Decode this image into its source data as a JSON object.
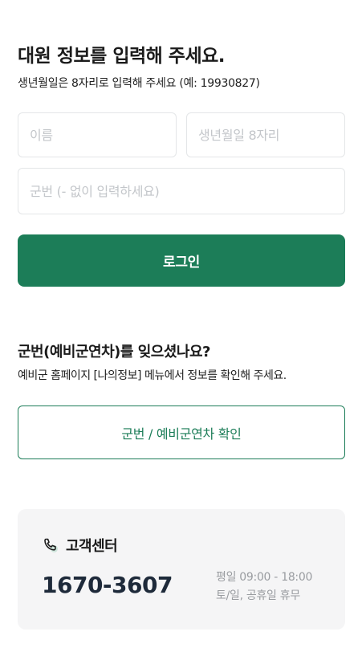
{
  "header": {
    "title": "대원 정보를 입력해 주세요.",
    "subtitle": "생년월일은 8자리로 입력해 주세요 (예: 19930827)"
  },
  "form": {
    "name_placeholder": "이름",
    "birth_placeholder": "생년월일 8자리",
    "service_number_placeholder": "군번 (- 없이 입력하세요)",
    "login_label": "로그인"
  },
  "forgot": {
    "title": "군번(예비군연차)를 잊으셨나요?",
    "description": "예비군 홈페이지 [나의정보] 메뉴에서 정보를 확인해 주세요.",
    "button_label": "군번 / 예비군연차 확인"
  },
  "customer_center": {
    "icon": "phone-icon",
    "title": "고객센터",
    "phone": "1670-3607",
    "hours_weekday": "평일 09:00 - 18:00",
    "hours_weekend": "토/일, 공휴일 휴무"
  },
  "colors": {
    "accent": "#1c7d58",
    "phone_text": "#1e2a3a",
    "muted": "#999ca0",
    "card_bg": "#f5f5f6"
  }
}
